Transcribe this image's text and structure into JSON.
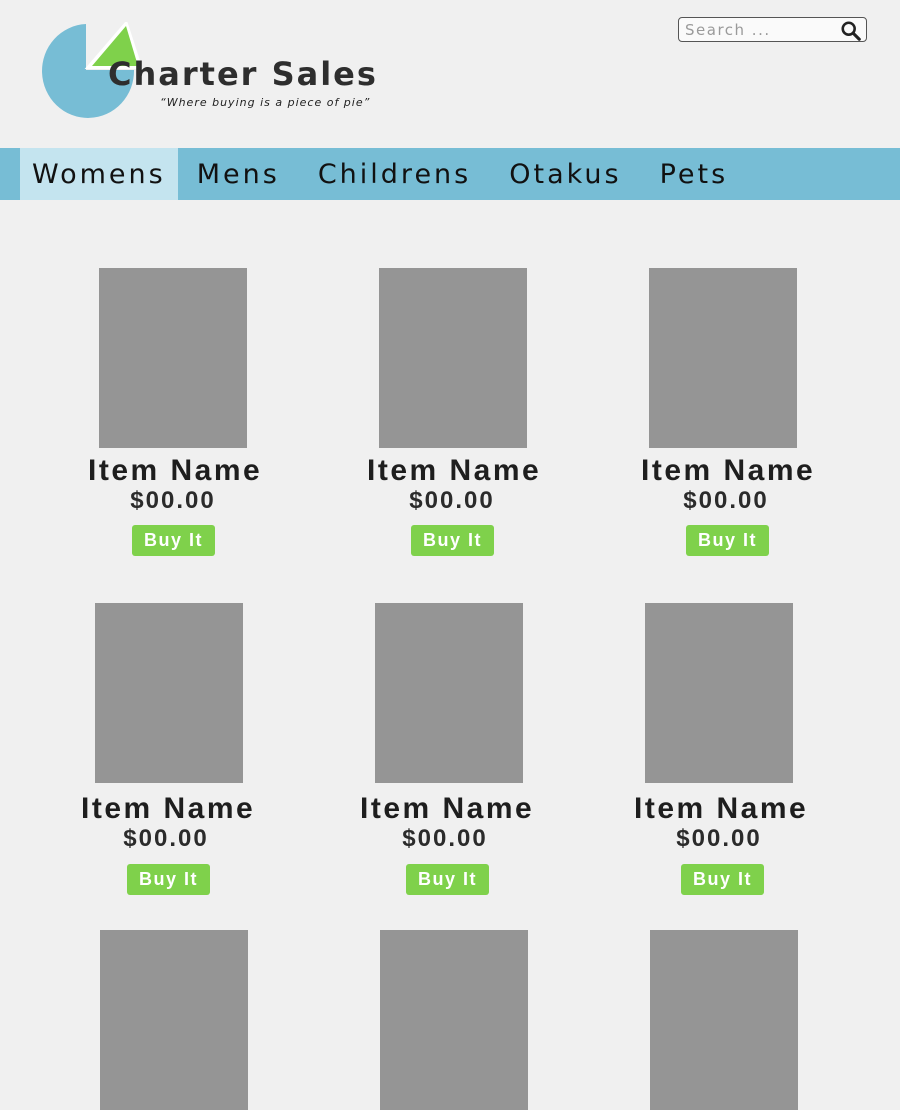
{
  "brand": {
    "name": "Charter Sales",
    "tagline": "“Where buying is a piece of pie”",
    "colors": {
      "pie_blue": "#77bdd5",
      "pie_green": "#7fd14b"
    }
  },
  "search": {
    "placeholder": "Search ...",
    "value": "",
    "icon": "search-icon"
  },
  "nav": {
    "items": [
      {
        "label": "Womens",
        "active": true
      },
      {
        "label": "Mens",
        "active": false
      },
      {
        "label": "Childrens",
        "active": false
      },
      {
        "label": "Otakus",
        "active": false
      },
      {
        "label": "Pets",
        "active": false
      }
    ],
    "accent": "#77bdd5",
    "active_bg": "#c4e4ef"
  },
  "products": [
    {
      "name": "Item Name",
      "price": "$00.00",
      "cta": "Buy It"
    },
    {
      "name": "Item Name",
      "price": "$00.00",
      "cta": "Buy It"
    },
    {
      "name": "Item Name",
      "price": "$00.00",
      "cta": "Buy It"
    },
    {
      "name": "Item Name",
      "price": "$00.00",
      "cta": "Buy It"
    },
    {
      "name": "Item Name",
      "price": "$00.00",
      "cta": "Buy It"
    },
    {
      "name": "Item Name",
      "price": "$00.00",
      "cta": "Buy It"
    },
    {
      "name": "",
      "price": "",
      "cta": ""
    },
    {
      "name": "",
      "price": "",
      "cta": ""
    },
    {
      "name": "",
      "price": "",
      "cta": ""
    }
  ],
  "button_color": "#7fd14b"
}
